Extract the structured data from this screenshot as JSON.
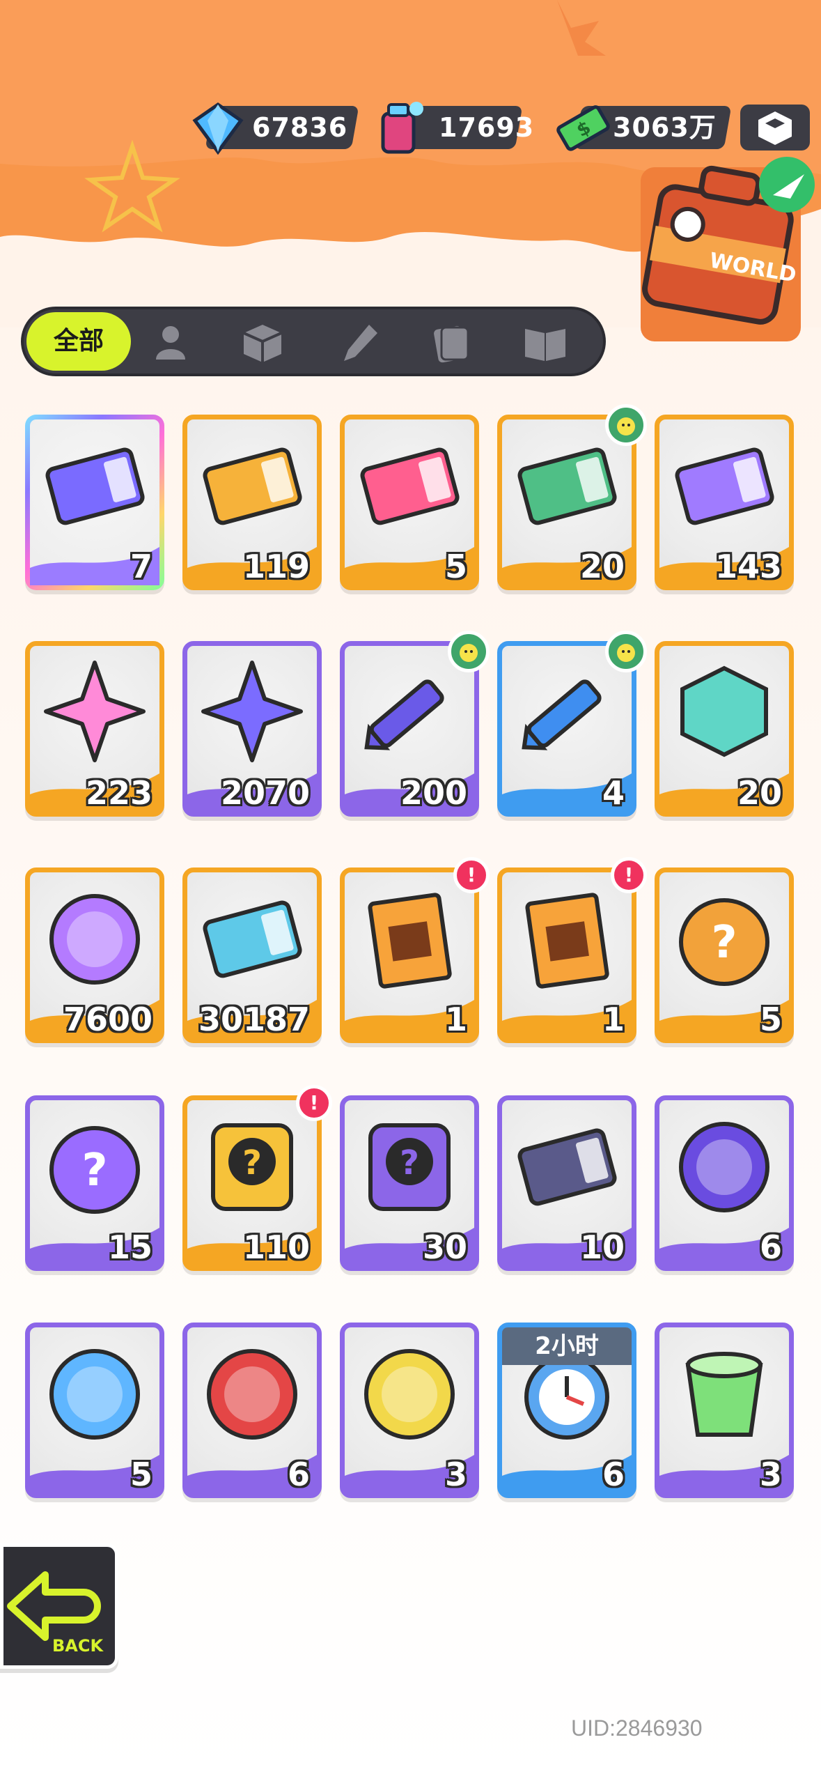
{
  "currency": {
    "diamonds": "67836",
    "paint": "17693",
    "cash": "3063万"
  },
  "tabs": {
    "all_label": "全部",
    "icons": [
      "person-icon",
      "box-icon",
      "brush-icon",
      "card-icon",
      "book-icon"
    ]
  },
  "items": [
    {
      "icon": "deity-ticket-crown-icon",
      "count": "7",
      "frame": "rainbow"
    },
    {
      "icon": "deity-ticket-star-icon",
      "count": "119",
      "frame": "orange"
    },
    {
      "icon": "character-ticket-icon",
      "count": "5",
      "frame": "orange"
    },
    {
      "icon": "bread-ticket-icon",
      "count": "20",
      "frame": "orange",
      "badge": "chick"
    },
    {
      "icon": "deity-ticket-purple-icon",
      "count": "143",
      "frame": "orange"
    },
    {
      "icon": "rainbow-star-icon",
      "count": "223",
      "frame": "orange"
    },
    {
      "icon": "purple-star-icon",
      "count": "2070",
      "frame": "purple"
    },
    {
      "icon": "purple-crayon-icon",
      "count": "200",
      "frame": "purple",
      "badge": "chick"
    },
    {
      "icon": "blue-crayon-icon",
      "count": "4",
      "frame": "blue",
      "badge": "chick"
    },
    {
      "icon": "color-cube-icon",
      "count": "20",
      "frame": "orange"
    },
    {
      "icon": "cool-badge-icon",
      "count": "7600",
      "frame": "orange"
    },
    {
      "icon": "season-ticket-icon",
      "count": "30187",
      "frame": "orange"
    },
    {
      "icon": "deity-pack-icon",
      "count": "1",
      "frame": "orange",
      "badge": "alert"
    },
    {
      "icon": "deity-pack-icon",
      "count": "1",
      "frame": "orange",
      "badge": "alert"
    },
    {
      "icon": "mystery-egg-orange-icon",
      "count": "5",
      "frame": "orange"
    },
    {
      "icon": "mystery-egg-purple-icon",
      "count": "15",
      "frame": "purple"
    },
    {
      "icon": "deity-mystery-gold-icon",
      "count": "110",
      "frame": "orange",
      "badge": "alert"
    },
    {
      "icon": "deity-mystery-purple-icon",
      "count": "30",
      "frame": "purple"
    },
    {
      "icon": "travel-card-icon",
      "count": "10",
      "frame": "purple"
    },
    {
      "icon": "mpets-cat-ball-icon",
      "count": "6",
      "frame": "purple"
    },
    {
      "icon": "mpets-fish-ball-icon",
      "count": "5",
      "frame": "purple"
    },
    {
      "icon": "mpets-shark-ball-icon",
      "count": "6",
      "frame": "purple"
    },
    {
      "icon": "mpets-jelly-ball-icon",
      "count": "3",
      "frame": "purple"
    },
    {
      "icon": "alarm-clock-icon",
      "count": "6",
      "frame": "blue",
      "timer": "2小时"
    },
    {
      "icon": "green-jelly-cup-icon",
      "count": "3",
      "frame": "purple"
    }
  ],
  "back_label": "BACK",
  "uid": "UID:2846930"
}
